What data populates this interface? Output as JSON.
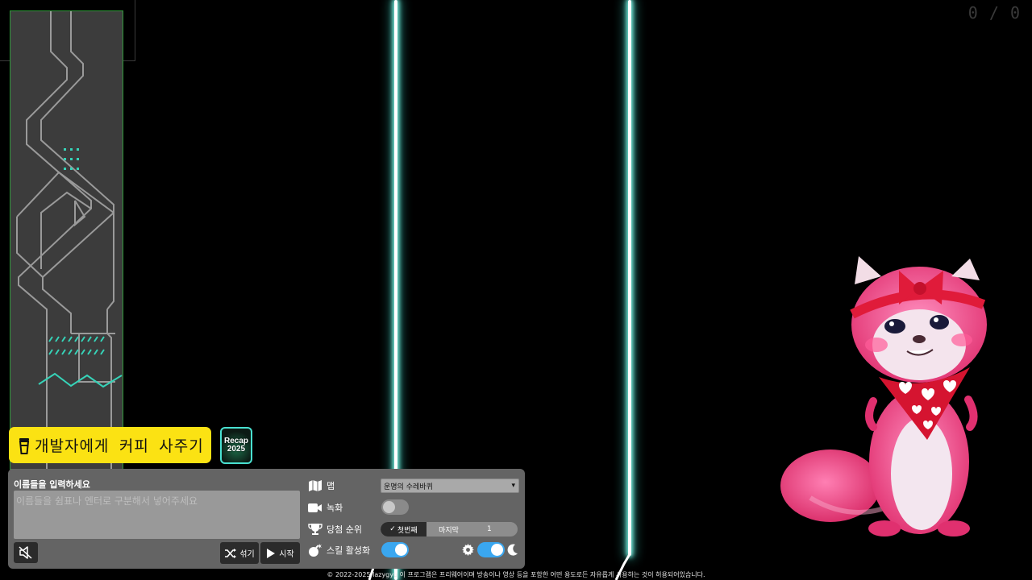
{
  "counter": "0 / 0",
  "coffee_button": {
    "label": "개발자에게 커피 사주기",
    "icon": "coffee-cup-icon",
    "color": "#fbe213"
  },
  "recap_button": {
    "line1": "Recap",
    "line2": "2025"
  },
  "panel": {
    "names_label": "이름들을 입력하세요",
    "names_placeholder": "이름들을 쉼표나 엔터로 구분해서 넣어주세요",
    "names_value": "",
    "shuffle_label": "섞기",
    "start_label": "시작",
    "map": {
      "label": "맵",
      "selected": "운명의 수레바퀴"
    },
    "recording": {
      "label": "녹화",
      "enabled": false
    },
    "rank": {
      "label": "당첨 순위",
      "first": "첫번째",
      "last": "마지막",
      "count": "1",
      "selected": "첫번째"
    },
    "skill": {
      "label": "스킬 활성화",
      "enabled": true
    },
    "theme": {
      "dark": true
    }
  },
  "footer": "© 2022-2025 lazygyu 이 프로그램은 프리웨어이며 방송이나 영상 등을 포함한 어떤 용도로든 자유롭게 사용하는 것이 허용되어있습니다.",
  "colors": {
    "accent": "#3aa7f0",
    "wall_glow": "#7df5e6",
    "panel": "#646464",
    "track_border": "#2f9a3a"
  }
}
